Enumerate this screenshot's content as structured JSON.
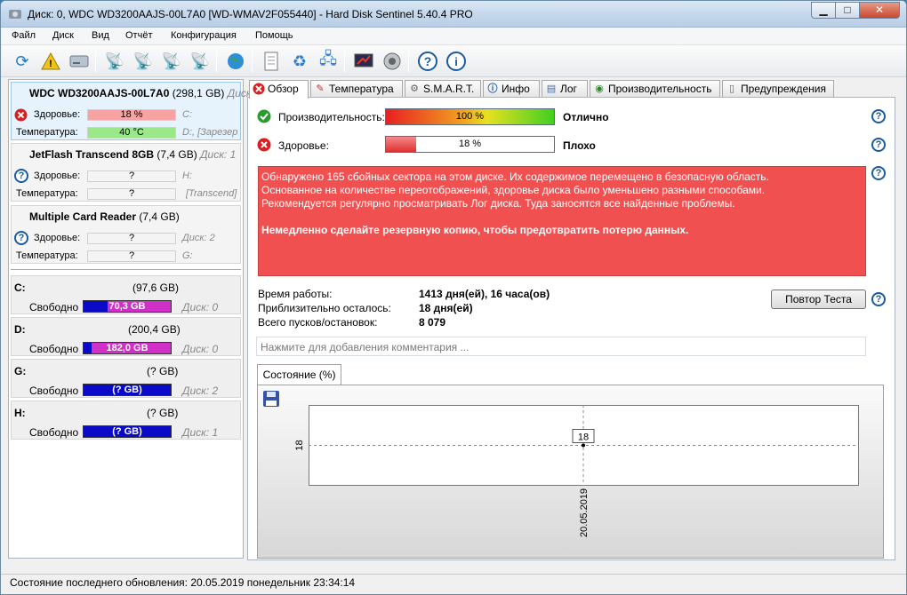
{
  "window": {
    "title": "Диск: 0, WDC WD3200AAJS-00L7A0 [WD-WMAV2F055440]  -  Hard Disk Sentinel 5.40.4 PRO"
  },
  "menu": [
    "Файл",
    "Диск",
    "Вид",
    "Отчёт",
    "Конфигурация",
    "Помощь"
  ],
  "toolbar_icons": [
    "refresh-icon",
    "warning-icon",
    "disk-icon",
    "satellite-dish-icon",
    "satellite-dish-icon",
    "satellite-dish-check-icon",
    "satellite-dish-icon",
    "globe-icon",
    "document-icon",
    "recycle-icon",
    "network-icon",
    "report-icon",
    "sound-icon",
    "help-icon",
    "info-icon"
  ],
  "disks": [
    {
      "name_bold": "WDC WD3200AAJS-00L7A0",
      "size": "(298,1 GB)",
      "tag": "Диск",
      "health_label": "Здоровье:",
      "health_value": "18 %",
      "health_pct": 18,
      "temp_label": "Температура:",
      "temp_value": "40 °C",
      "vol1": "C:",
      "vol2": "D:, [Зарезер"
    },
    {
      "name_bold": "JetFlash Transcend 8GB",
      "size": "(7,4 GB)",
      "tag": "Диск: 1",
      "health_label": "Здоровье:",
      "health_value": "?",
      "temp_label": "Температура:",
      "temp_value": "?",
      "vol1": "H:",
      "vol2": "[Transcend]"
    },
    {
      "name_bold": "Multiple Card  Reader",
      "size": "(7,4 GB)",
      "tag": "",
      "health_label": "Здоровье:",
      "health_value": "?",
      "temp_label": "Температура:",
      "temp_value": "?",
      "vol1": "Диск: 2",
      "vol2": "G:"
    }
  ],
  "volumes": [
    {
      "letter": "C:",
      "total": "(97,6 GB)",
      "free_label": "Свободно",
      "free": "70,3 GB",
      "disk": "Диск: 0",
      "free_pct": 72
    },
    {
      "letter": "D:",
      "total": "(200,4 GB)",
      "free_label": "Свободно",
      "free": "182,0 GB",
      "disk": "Диск: 0",
      "free_pct": 91
    },
    {
      "letter": "G:",
      "total": "(? GB)",
      "free_label": "Свободно",
      "free": "(? GB)",
      "disk": "Диск: 2",
      "free_pct": 0
    },
    {
      "letter": "H:",
      "total": "(? GB)",
      "free_label": "Свободно",
      "free": "(? GB)",
      "disk": "Диск: 1",
      "free_pct": 0
    }
  ],
  "tabs": [
    "Обзор",
    "Температура",
    "S.M.A.R.T.",
    "Инфо",
    "Лог",
    "Производительность",
    "Предупреждения"
  ],
  "overview": {
    "performance_label": "Производительность:",
    "performance_value": "100 %",
    "performance_pct": 100,
    "performance_rating": "Отлично",
    "health_label": "Здоровье:",
    "health_value": "18 %",
    "health_pct": 18,
    "health_rating": "Плохо",
    "message_lines": [
      "Обнаружено 165 сбойных сектора на этом диске. Их содержимое перемещено в безопасную область.",
      "Основанное на количестве переотображений, здоровье диска было уменьшено разными способами.",
      "Рекомендуется регулярно просматривать Лог диска. Туда заносятся все найденные проблемы."
    ],
    "message_bold": "Немедленно сделайте резервную копию, чтобы предотвратить потерю данных.",
    "uptime_label": "Время работы:",
    "uptime_value": "1413 дня(ей), 16 часа(ов)",
    "remaining_label": "Приблизительно осталось:",
    "remaining_value": "18 дня(ей)",
    "starts_label": "Всего пусков/остановок:",
    "starts_value": "8 079",
    "retest_button": "Повтор Теста",
    "comment_placeholder": "Нажмите для добавления комментария ...",
    "state_tab": "Состояние (%)"
  },
  "chart_data": {
    "type": "line",
    "x": [
      "20.05.2019"
    ],
    "series": [
      {
        "values": [
          18
        ]
      }
    ],
    "yticks": [
      "18"
    ],
    "data_labels": [
      "18"
    ],
    "grid": true
  },
  "status": "Состояние последнего обновления: 20.05.2019 понедельник 23:34:14"
}
